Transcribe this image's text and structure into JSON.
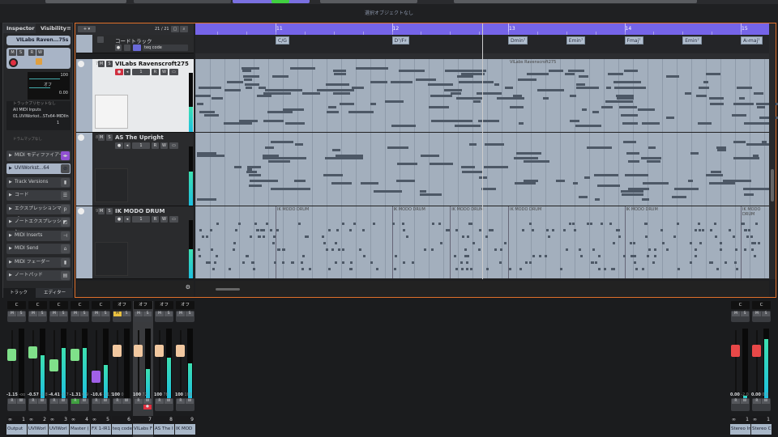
{
  "status": "選択オブジェクトなし",
  "inspector": {
    "tabs": [
      "Inspector",
      "Visibility"
    ],
    "track_name": "VILabs Raven...75s",
    "volume": "100",
    "pan": "オフ",
    "delay": "0.00",
    "preset": "トラックプリセットなし",
    "input": "All MIDI Inputs",
    "output": "01.UVIWorkst...STx64-MIDIIn",
    "channel": "1",
    "drum_map": "ドラムマップなし",
    "sections": [
      "MIDI モディファイアー",
      "UVIWorkst...64",
      "Track Versions",
      "コード",
      "エクスプレッションマップ",
      "ノートエクスプレッション",
      "MIDI Inserts",
      "MIDI Send",
      "MIDI フェーダー",
      "ノートパッド"
    ],
    "bottom_tabs": [
      "トラック",
      "エディター"
    ]
  },
  "project": {
    "track_count": "21 / 21",
    "chord_track": {
      "name": "コードトラック",
      "mode": "teq code"
    },
    "tracks": [
      {
        "num": "7",
        "name": "VILabs Ravenscroft275",
        "ch": "1",
        "meter": 0.42
      },
      {
        "num": "8",
        "name": "AS The Upright",
        "ch": "1",
        "meter": 0.58
      },
      {
        "num": "9",
        "name": "IK MODO DRUM",
        "ch": "1",
        "meter": 0.5
      }
    ],
    "bars": [
      "11",
      "12",
      "13",
      "14",
      "15"
    ],
    "chords": [
      {
        "label": "C/G",
        "bar": 11
      },
      {
        "label": "D⁷/F♯",
        "bar": 12
      },
      {
        "label": "Dmin⁷",
        "bar": 13.0
      },
      {
        "label": "Emin⁷",
        "bar": 13.5
      },
      {
        "label": "Fmaj⁷",
        "bar": 14
      },
      {
        "label": "Emin⁷",
        "bar": 14.5
      },
      {
        "label": "A♭maj⁷",
        "bar": 15
      }
    ],
    "cursor_bar": 12.78,
    "piano_event_label": "VILabs Ravenscroft275",
    "drum_event_label": "IK MODO DRUM"
  },
  "mixer": {
    "channels": [
      {
        "num": "1",
        "name": "Output",
        "pan": "C",
        "vol": "-1.15",
        "peak": "-oo",
        "fader": 0.75,
        "meter": 0,
        "color": "#7fe08a",
        "link": true
      },
      {
        "num": "2",
        "name": "UVIWorl",
        "pan": "C",
        "vol": "-0.57",
        "peak": "-2.8",
        "fader": 0.78,
        "meter": 0.62,
        "color": "#7fe08a",
        "link": true
      },
      {
        "num": "3",
        "name": "UVIWorl",
        "pan": "C",
        "vol": "-4.41",
        "peak": "-5.7",
        "fader": 0.6,
        "meter": 0.72,
        "color": "#7fe08a",
        "link": true
      },
      {
        "num": "4",
        "name": "Master (",
        "pan": "C",
        "vol": "-1.31",
        "peak": "0.9",
        "fader": 0.74,
        "meter": 0.72,
        "color": "#7fe08a",
        "link": true,
        "read_on": true
      },
      {
        "num": "5",
        "name": "FX 1-IR1",
        "pan": "C",
        "vol": "-10.6",
        "peak": "-11.5",
        "fader": 0.45,
        "meter": 0.48,
        "color": "#a060e8",
        "link": true
      },
      {
        "num": "6",
        "name": "teq code",
        "pan": "オフ",
        "vol": "100",
        "peak": "0",
        "fader": 0.8,
        "meter": 0,
        "color": "#f2c8a0",
        "mute_on": true
      },
      {
        "num": "7",
        "name": "VILabs F",
        "pan": "オフ",
        "vol": "100",
        "peak": "72",
        "fader": 0.8,
        "meter": 0.42,
        "color": "#f2c8a0",
        "selected": true,
        "rec": true
      },
      {
        "num": "8",
        "name": "AS The I",
        "pan": "オフ",
        "vol": "100",
        "peak": "78",
        "fader": 0.8,
        "meter": 0.58,
        "color": "#f2c8a0"
      },
      {
        "num": "9",
        "name": "IK MOD",
        "pan": "オフ",
        "vol": "100",
        "peak": "100",
        "fader": 0.8,
        "meter": 0.5,
        "color": "#f2c8a0"
      }
    ],
    "outputs": [
      {
        "num": "1",
        "name": "Stereo In",
        "pan": "C",
        "vol": "0.00",
        "peak": "-2.0",
        "fader": 0.8,
        "meter": 0.03,
        "color": "#e84848",
        "link": true
      },
      {
        "num": "1",
        "name": "Stereo C",
        "pan": "C",
        "vol": "0.00",
        "peak": "0.0",
        "fader": 0.8,
        "meter": 0.85,
        "color": "#e84848",
        "link": true
      }
    ]
  },
  "labels": {
    "M": "M",
    "S": "S",
    "R": "R",
    "W": "W"
  }
}
